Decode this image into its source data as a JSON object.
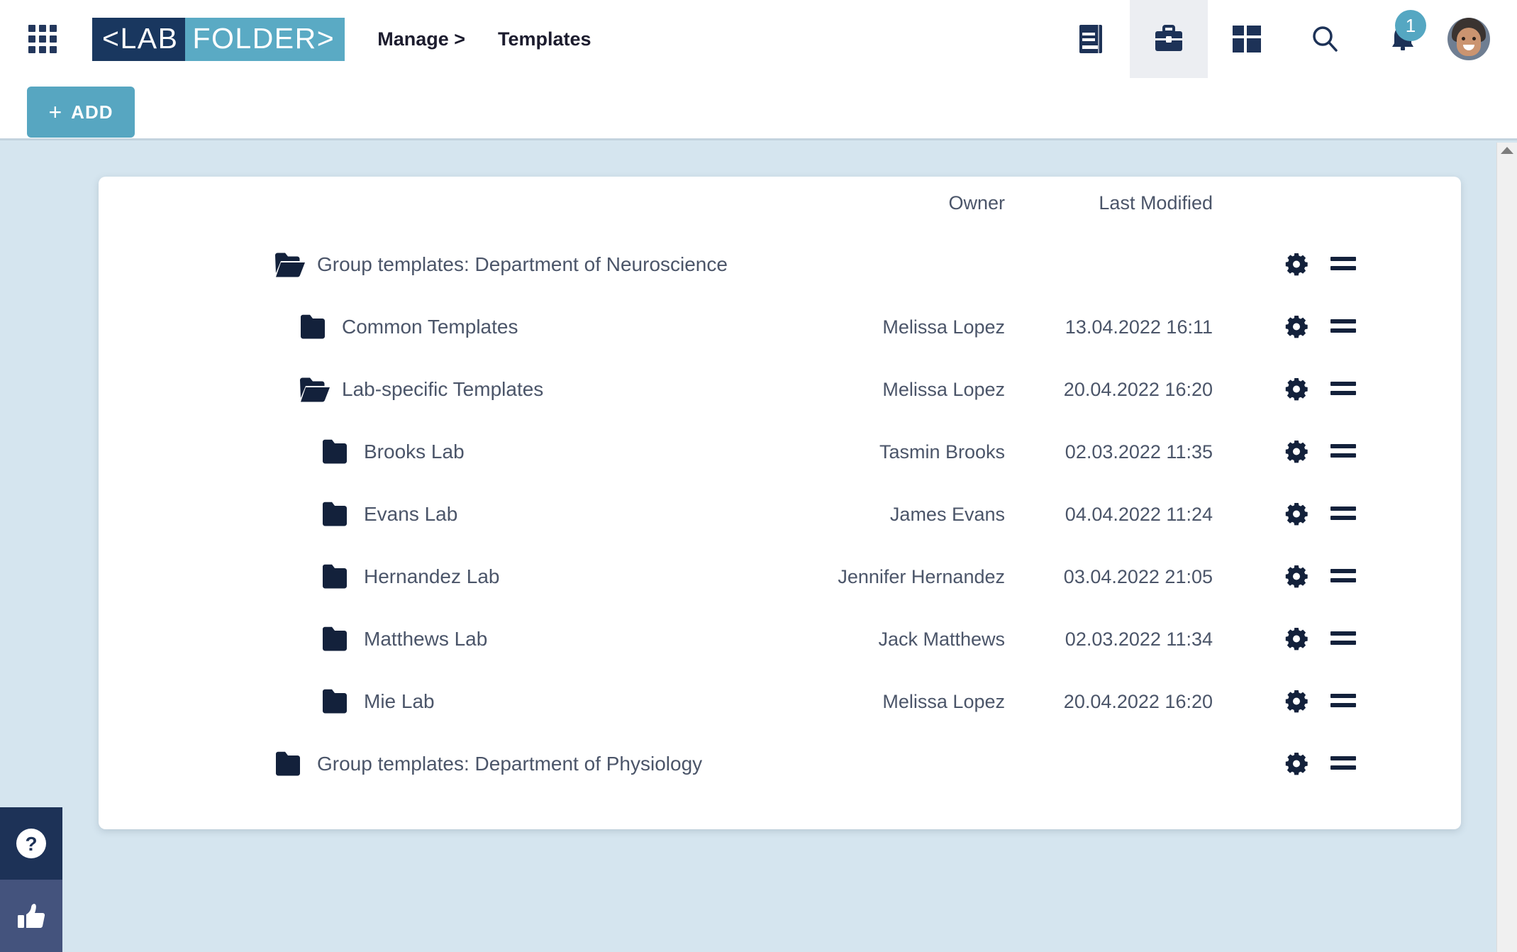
{
  "app": {
    "logo_left": "<LAB",
    "logo_right": "FOLDER>",
    "grid_icon": "apps-grid-icon"
  },
  "nav": {
    "items": [
      {
        "label": "Manage >",
        "name": "nav-manage"
      },
      {
        "label": "Templates",
        "name": "nav-templates"
      }
    ]
  },
  "toolbar": {
    "icons": [
      {
        "name": "notebook-icon",
        "active": false
      },
      {
        "name": "briefcase-icon",
        "active": true
      },
      {
        "name": "dashboard-icon",
        "active": false
      },
      {
        "name": "search-icon",
        "active": false
      },
      {
        "name": "bell-icon",
        "active": false
      }
    ],
    "notification_count": "1",
    "avatar": "user-avatar"
  },
  "actionbar": {
    "add_label": "ADD",
    "add_plus": "+"
  },
  "table": {
    "headers": {
      "owner": "Owner",
      "last_modified": "Last Modified"
    },
    "rows": [
      {
        "name": "Group templates: Department of Neuroscience",
        "owner": "",
        "modified": "",
        "indent": 0,
        "folder": "open"
      },
      {
        "name": "Common Templates",
        "owner": "Melissa Lopez",
        "modified": "13.04.2022 16:11",
        "indent": 1,
        "folder": "closed"
      },
      {
        "name": "Lab-specific Templates",
        "owner": "Melissa Lopez",
        "modified": "20.04.2022 16:20",
        "indent": 1,
        "folder": "open"
      },
      {
        "name": "Brooks Lab",
        "owner": "Tasmin Brooks",
        "modified": "02.03.2022 11:35",
        "indent": 2,
        "folder": "closed"
      },
      {
        "name": "Evans Lab",
        "owner": "James Evans",
        "modified": "04.04.2022 11:24",
        "indent": 2,
        "folder": "closed"
      },
      {
        "name": "Hernandez Lab",
        "owner": "Jennifer Hernandez",
        "modified": "03.04.2022 21:05",
        "indent": 2,
        "folder": "closed"
      },
      {
        "name": "Matthews Lab",
        "owner": "Jack Matthews",
        "modified": "02.03.2022 11:34",
        "indent": 2,
        "folder": "closed"
      },
      {
        "name": "Mie Lab",
        "owner": "Melissa Lopez",
        "modified": "20.04.2022 16:20",
        "indent": 2,
        "folder": "closed"
      },
      {
        "name": "Group templates: Department of Physiology",
        "owner": "",
        "modified": "",
        "indent": 0,
        "folder": "closed"
      }
    ],
    "row_actions": {
      "settings": "gear-icon",
      "drag": "drag-handle-icon"
    }
  },
  "help_widgets": [
    {
      "name": "help-question-button",
      "icon": "question-mark-icon"
    },
    {
      "name": "feedback-thumbs-up-button",
      "icon": "thumbs-up-icon"
    }
  ],
  "colors": {
    "brand_dark": "#19375f",
    "brand_light": "#5aaac4",
    "page_bg": "#d5e5ef",
    "text": "#4b5569",
    "icon_navy": "#13213b",
    "accent": "#57a6c1"
  }
}
